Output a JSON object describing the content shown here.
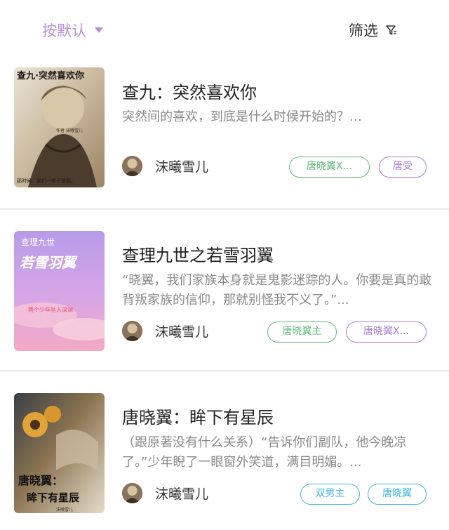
{
  "toolbar": {
    "sort_label": "按默认",
    "filter_label": "筛选"
  },
  "books": [
    {
      "title": "查九：突然喜欢你",
      "description": "突然间的喜欢，到底是什么时候开始的？…",
      "author": "沫曦雪儿",
      "cover_text": "查九·突然喜欢你",
      "cover_subtext": "作者 沫曦雪儿",
      "cover_bottom_text": "那时候、我们一辈子是我。",
      "tags": [
        {
          "label": "唐晓翼X...",
          "color": "#5fb878"
        },
        {
          "label": "唐受",
          "color": "#a97dd6"
        }
      ]
    },
    {
      "title": "查理九世之若雪羽翼",
      "description": "“晓翼，我们家族本身就是鬼影迷踪的人。你要是真的敢背叛家族的信仰，那就别怪我不义了。”...",
      "author": "沫曦雪儿",
      "cover_text": "查理九世",
      "cover_subtext": "若雪羽翼",
      "cover_bottom_text": "两个少年坠入深渊",
      "tags": [
        {
          "label": "唐晓翼主",
          "color": "#5fb878"
        },
        {
          "label": "唐晓翼X...",
          "color": "#a97dd6"
        }
      ]
    },
    {
      "title": "唐晓翼：眸下有星辰",
      "description": "（跟原著没有什么关系）“告诉你们副队，他今晚凉了。”少年睨了一眼窗外笑道，满目明媚。...",
      "author": "沫曦雪儿",
      "cover_text": "唐晓翼：",
      "cover_subtext": "眸下有星辰",
      "cover_bottom_text": "沫曦雪儿",
      "tags": [
        {
          "label": "双男主",
          "color": "#3fb8dc"
        },
        {
          "label": "唐晓翼",
          "color": "#3fb8dc"
        }
      ]
    }
  ]
}
